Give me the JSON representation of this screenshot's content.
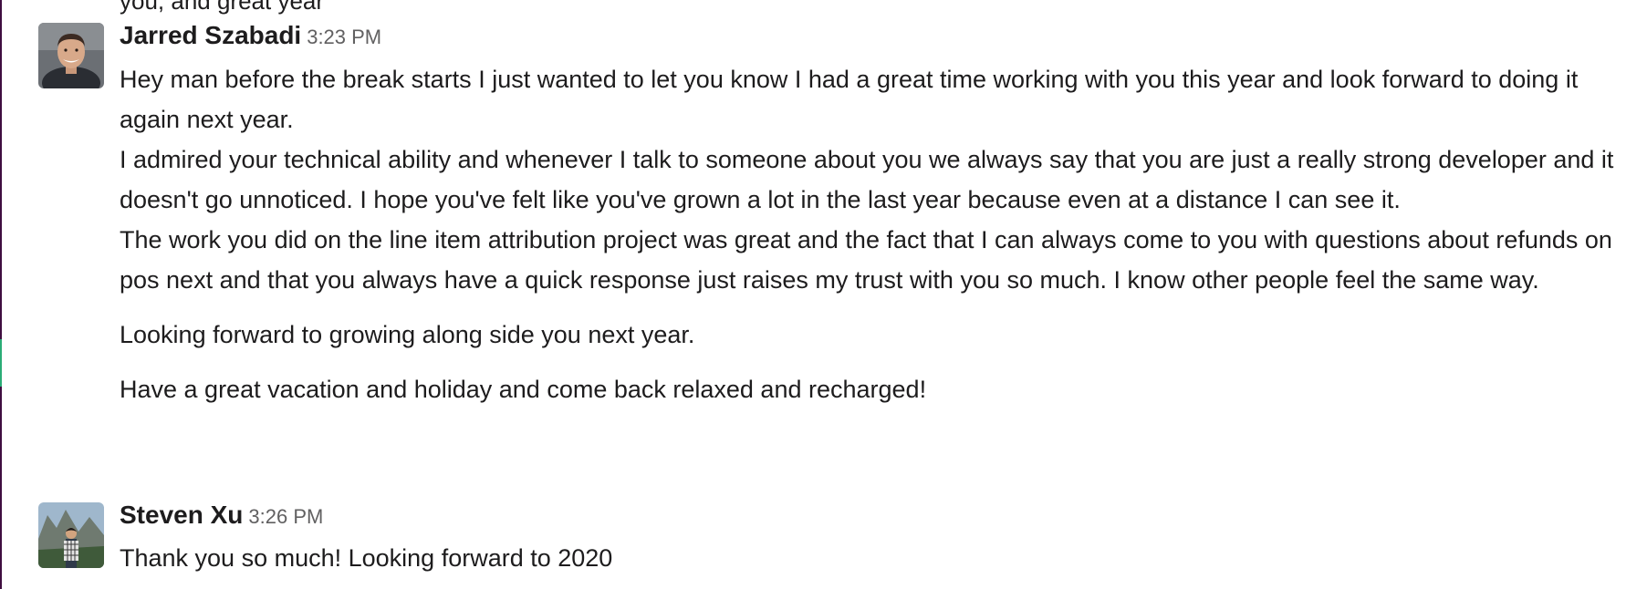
{
  "previous_message_fragment": "you, and great year",
  "messages": [
    {
      "sender": "Jarred Szabadi",
      "time": "3:23 PM",
      "avatar_icon": "person-avatar-icon",
      "lines": [
        "Hey man before the break starts I just wanted to let you know I had a great time working with you this year and look forward to doing it again next year.",
        "I admired your technical ability and whenever I talk to someone about you we always say that you are just a really strong developer and it doesn't go unnoticed. I hope you've felt like you've grown a lot in the last year because even at a distance I can see it.",
        "The work you did on the line item attribution project was great and the fact that I can always come to you with questions about refunds on pos next and that you always have a quick response just raises my trust with you so much. I know other people feel the same way.",
        "Looking forward to growing along side you next year.",
        "Have a great vacation and holiday and come back relaxed and recharged!"
      ]
    },
    {
      "sender": "Steven Xu",
      "time": "3:26 PM",
      "avatar_icon": "person-outdoors-avatar-icon",
      "lines": [
        "Thank you so much! Looking forward to 2020"
      ]
    }
  ],
  "colors": {
    "text": "#1d1c1d",
    "timestamp": "#616061",
    "rail": "#3f0e40",
    "rail_mark": "#2bac76"
  }
}
